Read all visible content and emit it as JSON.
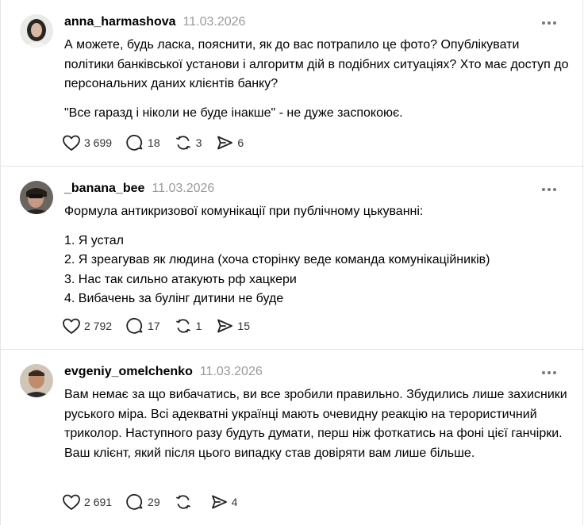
{
  "posts": [
    {
      "username": "anna_harmashova",
      "date": "11.03.2026",
      "paragraphs": [
        "А можете, будь ласка, пояснити, як до вас потрапило це фото? Опублікувати політики банківської установи і алгоритм дій в подібних ситуаціях? Хто має доступ до персональних даних клієнтів банку?",
        "\"Все гаразд і ніколи не буде інакше\" - не дуже заспокоює."
      ],
      "likes": "3 699",
      "replies": "18",
      "reposts": "3",
      "shares": "6"
    },
    {
      "username": "_banana_bee",
      "date": "11.03.2026",
      "paragraphs": [
        "Формула антикризової комунікації при публічному цькуванні:",
        "1. Я устал",
        "2. Я зреагував як людина (хоча сторінку веде команда комунікаційників)",
        "3. Нас так сильно атакують рф хацкери",
        "4. Вибачень за булінг дитини не буде"
      ],
      "likes": "2 792",
      "replies": "17",
      "reposts": "1",
      "shares": "15"
    },
    {
      "username": "evgeniy_omelchenko",
      "date": "11.03.2026",
      "paragraphs": [
        "Вам немає за що вибачатись, ви все зробили правильно. Збудились лише захисники руського міра. Всі адекватні українці мають очевидну реакцію на терористичний триколор. Наступного разу будуть думати, перш ніж фоткатись на фоні цієї ганчірки. Ваш клієнт, який після цього випадку став довіряти вам лише більше."
      ],
      "likes": "2 691",
      "replies": "29",
      "reposts": "",
      "shares": "4"
    }
  ],
  "icons": {
    "like": "heart-icon",
    "reply": "comment-icon",
    "repost": "repost-icon",
    "share": "share-icon",
    "more": "more-icon"
  }
}
